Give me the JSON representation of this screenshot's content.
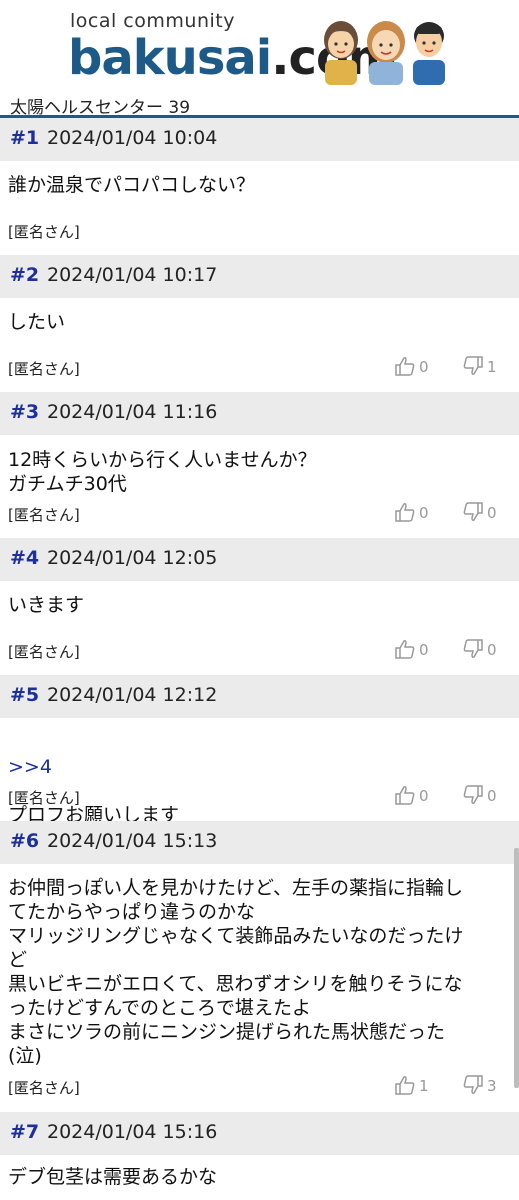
{
  "header": {
    "logo_sub": "local community",
    "logo_main": "bakusai",
    "logo_tld": ".com"
  },
  "thread": {
    "title": "太陽ヘルスセンター 39"
  },
  "posts": [
    {
      "num": "#1",
      "date": "2024/01/04 10:04",
      "body": "誰か温泉でパコパコしない？",
      "author": "[匿名さん]"
    },
    {
      "num": "#2",
      "date": "2024/01/04 10:17",
      "body": "したい",
      "author": "[匿名さん]",
      "likes": "0",
      "dislikes": "1"
    },
    {
      "num": "#3",
      "date": "2024/01/04 11:16",
      "body": "12時くらいから行く人いませんか？\nガチムチ30代",
      "author": "[匿名さん]",
      "likes": "0",
      "dislikes": "0"
    },
    {
      "num": "#4",
      "date": "2024/01/04 12:05",
      "body": "いきます",
      "author": "[匿名さん]",
      "likes": "0",
      "dislikes": "0"
    },
    {
      "num": "#5",
      "date": "2024/01/04 12:12",
      "anchor": ">>4",
      "body": "プロフお願いします",
      "author": "[匿名さん]",
      "likes": "0",
      "dislikes": "0"
    },
    {
      "num": "#6",
      "date": "2024/01/04 15:13",
      "body": "お仲間っぽい人を見かけたけど、左手の薬指に指輪し\nてたからやっぱり違うのかな\nマリッジリングじゃなくて装飾品みたいなのだったけ\nど\n黒いビキニがエロくて、思わずオシリを触りそうにな\nったけどすんでのところで堪えたよ\nまさにツラの前にニンジン提げられた馬状態だった\n(泣)",
      "author": "[匿名さん]",
      "likes": "1",
      "dislikes": "3"
    },
    {
      "num": "#7",
      "date": "2024/01/04 15:16",
      "body": "デブ包茎は需要あるかな"
    }
  ]
}
